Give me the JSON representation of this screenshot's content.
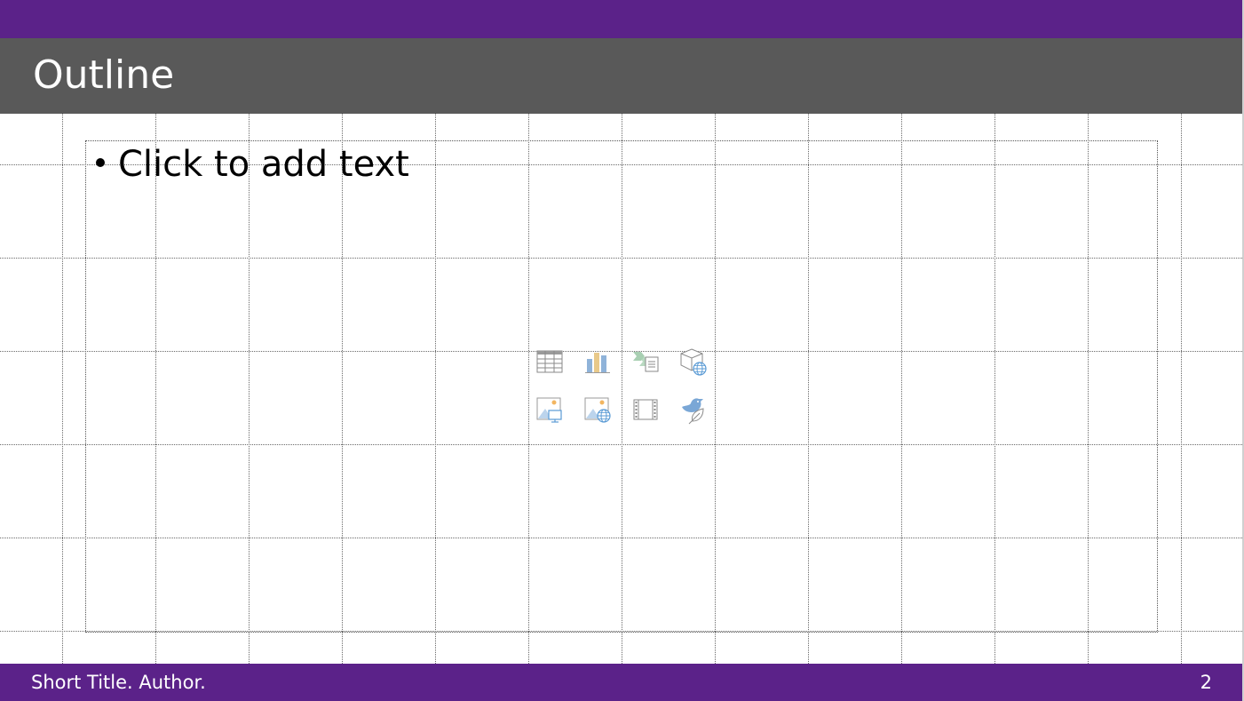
{
  "slide": {
    "title": "Outline",
    "body_placeholder": "Click to add text",
    "footer": "Short Title. Author.",
    "slide_number": "2"
  },
  "insert_icons": [
    {
      "name": "table-icon",
      "label": "Insert Table"
    },
    {
      "name": "chart-icon",
      "label": "Insert Chart"
    },
    {
      "name": "smartart-icon",
      "label": "Insert a SmartArt Graphic"
    },
    {
      "name": "3d-model-icon",
      "label": "3D Models"
    },
    {
      "name": "picture-icon",
      "label": "Pictures"
    },
    {
      "name": "online-picture-icon",
      "label": "Online Pictures"
    },
    {
      "name": "video-icon",
      "label": "Insert Video"
    },
    {
      "name": "icons-icon",
      "label": "Insert an Icon"
    }
  ],
  "colors": {
    "accent": "#5b2289",
    "title_bar": "#595959",
    "grid": "#6a6a6a"
  }
}
